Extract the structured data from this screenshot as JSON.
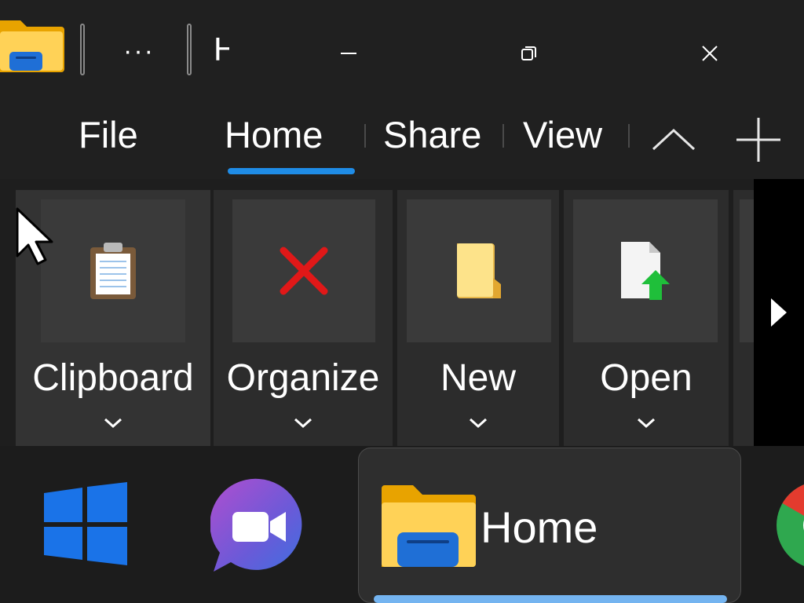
{
  "titlebar": {
    "app_icon": "folder-icon",
    "more_label": "···",
    "title_partial": "H",
    "minimize_icon": "minimize-icon",
    "restore_icon": "restore-icon",
    "close_icon": "close-icon"
  },
  "ribbon_tabs": {
    "tabs": [
      {
        "label": "File"
      },
      {
        "label": "Home",
        "selected": true
      },
      {
        "label": "Share"
      },
      {
        "label": "View"
      }
    ],
    "collapse_icon": "chevron-up-icon",
    "new_tab_icon": "plus-icon",
    "accent_color": "#1f8ce6"
  },
  "ribbon_groups": [
    {
      "label": "Clipboard",
      "icon": "clipboard-icon"
    },
    {
      "label": "Organize",
      "icon": "delete-x-icon"
    },
    {
      "label": "New",
      "icon": "new-folder-icon"
    },
    {
      "label": "Open",
      "icon": "open-file-icon"
    }
  ],
  "ribbon_scroll_icon": "chevron-right-icon",
  "taskbar": {
    "items": [
      {
        "name": "start",
        "icon": "windows-logo-icon"
      },
      {
        "name": "teams-chat",
        "icon": "video-chat-icon"
      },
      {
        "name": "file-explorer",
        "icon": "folder-icon",
        "label": "Home",
        "active": true
      },
      {
        "name": "chrome",
        "icon": "chrome-icon"
      }
    ],
    "indicator_color": "#74b4f0"
  }
}
